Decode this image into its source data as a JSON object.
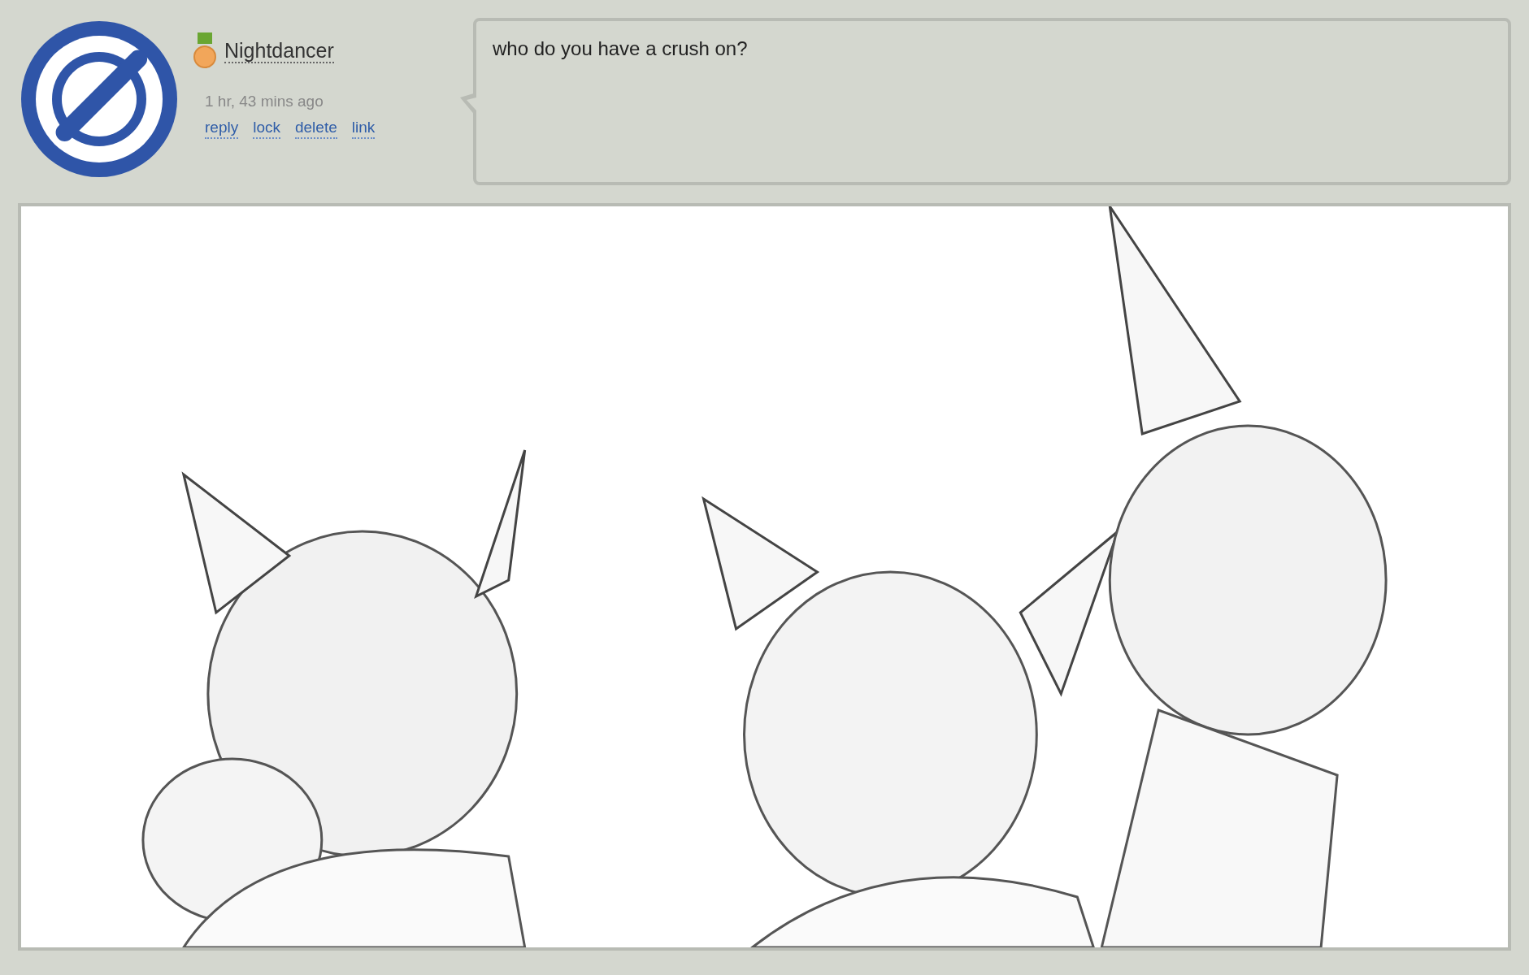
{
  "post": {
    "author": "Nightdancer",
    "time": "1 hr, 43 mins ago",
    "actions": [
      {
        "label": "reply"
      },
      {
        "label": "lock"
      },
      {
        "label": "delete"
      },
      {
        "label": "link"
      }
    ],
    "question": "who do you have a crush on?"
  }
}
